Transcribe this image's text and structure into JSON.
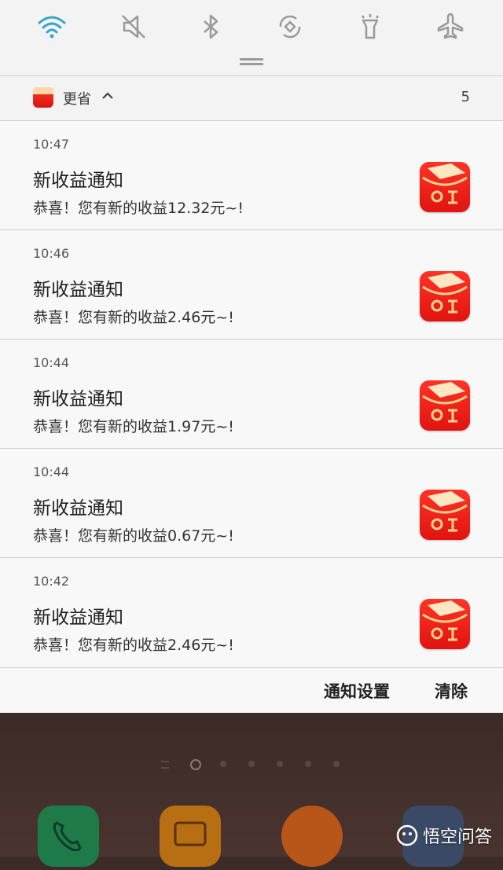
{
  "quick_settings": {
    "icons": [
      "wifi-icon",
      "mute-icon",
      "bluetooth-icon",
      "auto-rotate-icon",
      "flashlight-icon",
      "airplane-mode-icon"
    ],
    "wifi_color": "#35a7c8",
    "icon_color": "#9a9a9a"
  },
  "app_group": {
    "name": "更省",
    "count": "5"
  },
  "notifications": [
    {
      "time": "10:47",
      "title": "新收益通知",
      "body": "恭喜！您有新的收益12.32元~!"
    },
    {
      "time": "10:46",
      "title": "新收益通知",
      "body": "恭喜！您有新的收益2.46元~!"
    },
    {
      "time": "10:44",
      "title": "新收益通知",
      "body": "恭喜！您有新的收益1.97元~!"
    },
    {
      "time": "10:44",
      "title": "新收益通知",
      "body": "恭喜！您有新的收益0.67元~!"
    },
    {
      "time": "10:42",
      "title": "新收益通知",
      "body": "恭喜！您有新的收益2.46元~!"
    }
  ],
  "footer": {
    "settings_label": "通知设置",
    "clear_label": "清除"
  },
  "home": {
    "dock_apps": [
      "phone-app-icon",
      "messages-app-icon",
      "uc-browser-app-icon",
      "camera-app-icon"
    ]
  },
  "watermark": {
    "text": "悟空问答"
  }
}
